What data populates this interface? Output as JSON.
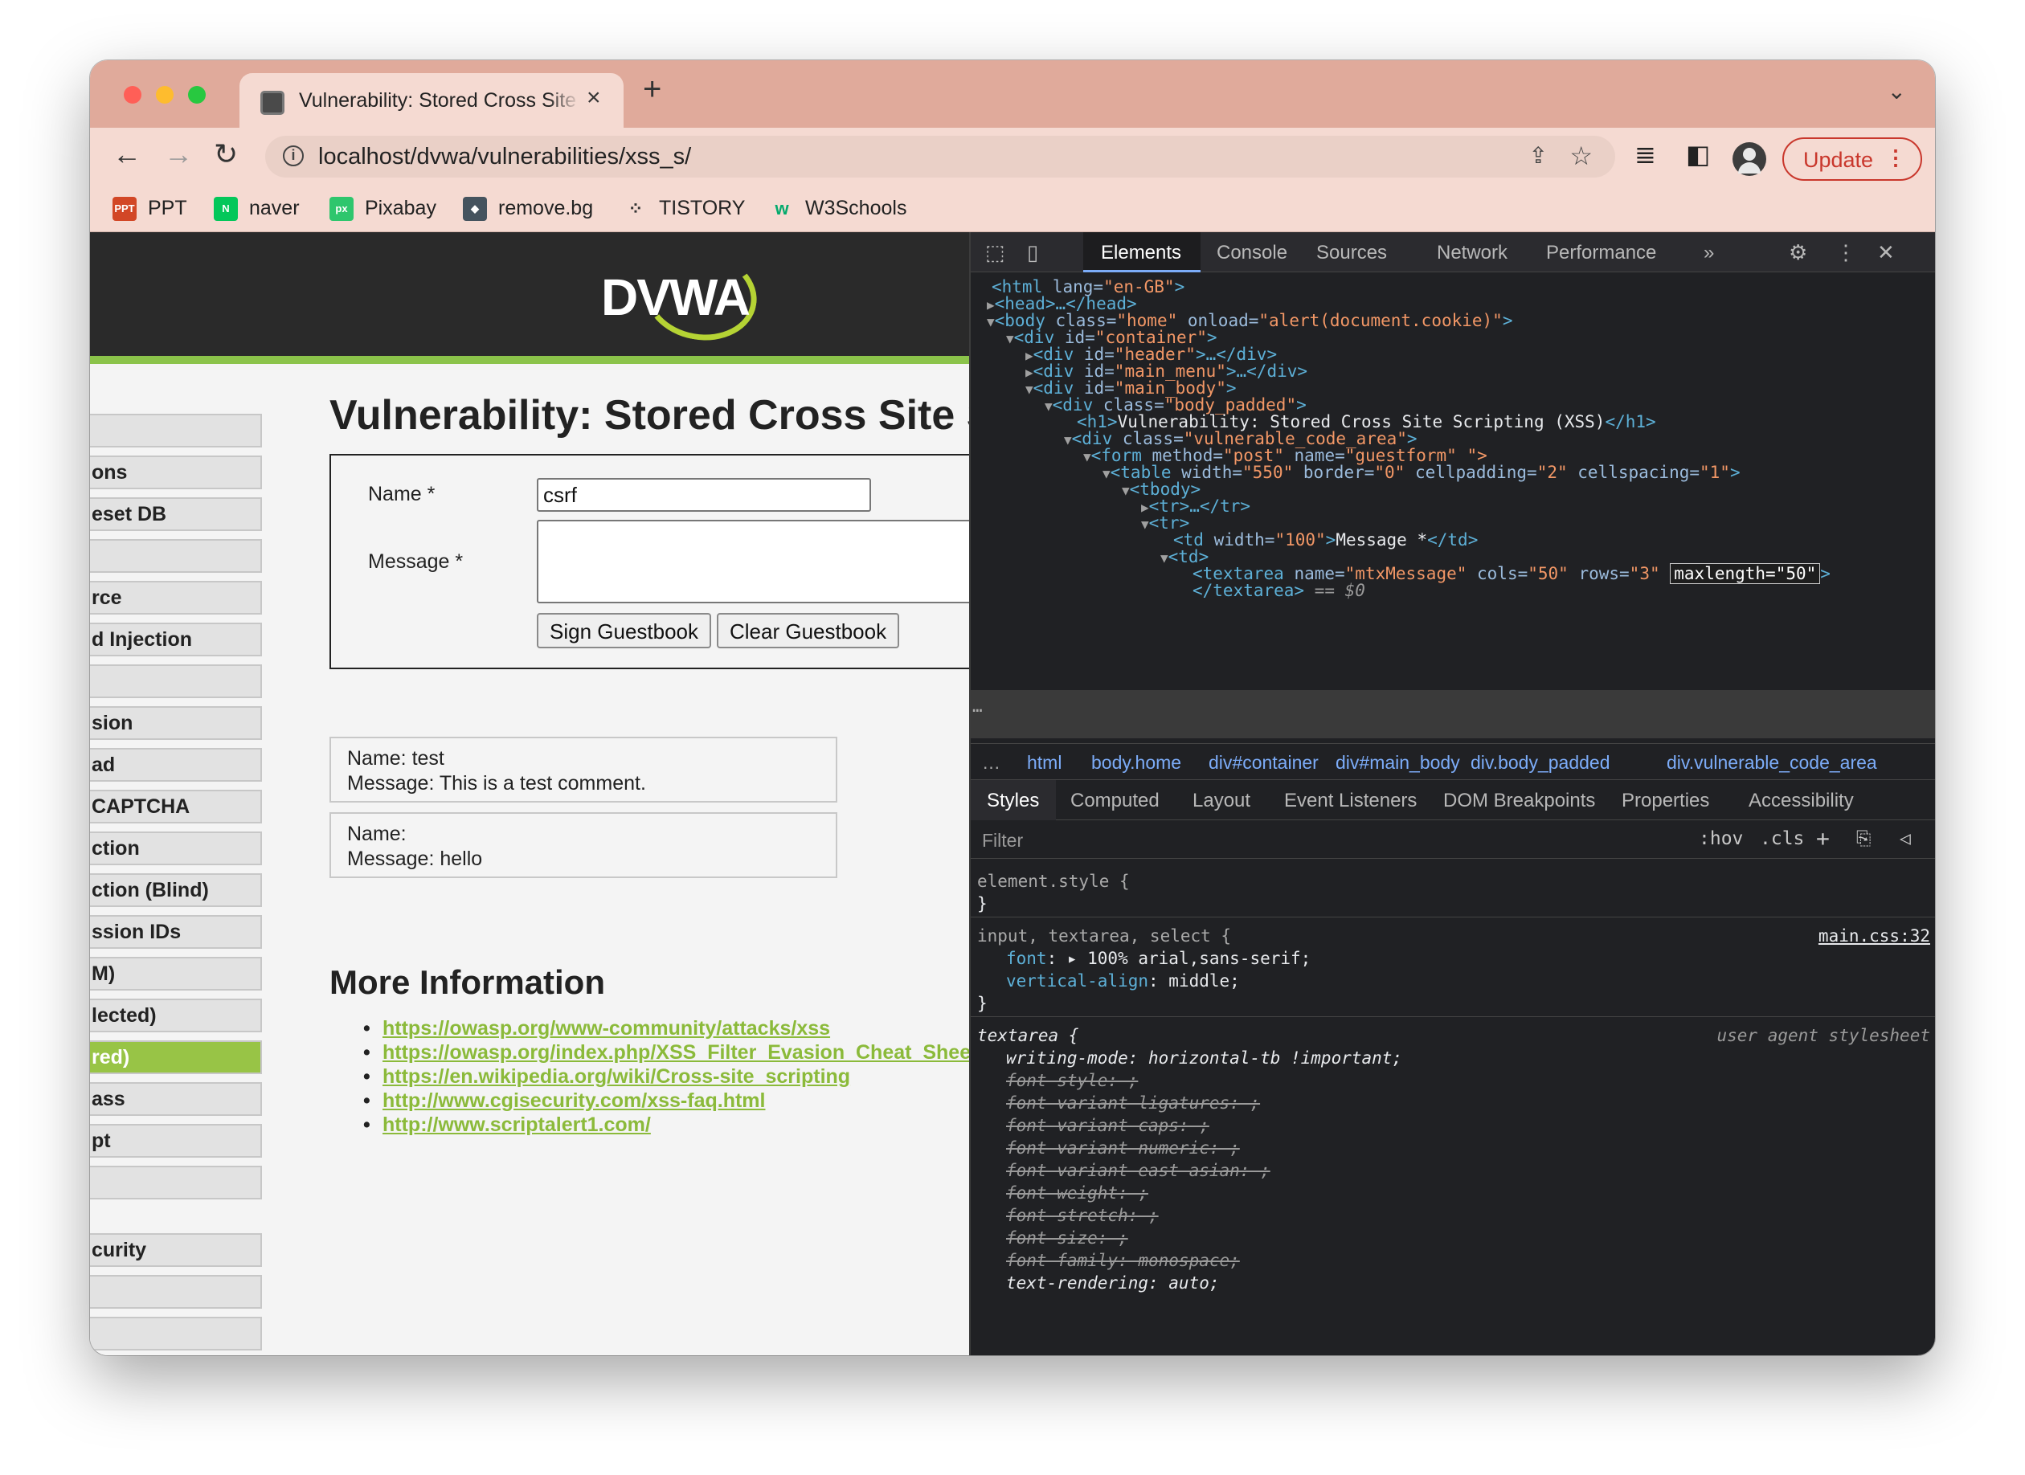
{
  "browser": {
    "tab_title": "Vulnerability: Stored Cross Site Scripting (XSS)",
    "tab_close": "×",
    "new_tab": "+",
    "url": "localhost/dvwa/vulnerabilities/xss_s/",
    "update_label": "Update",
    "bookmarks": [
      {
        "label": "PPT",
        "icon": "ppt-icon",
        "color": "#d24726"
      },
      {
        "label": "naver",
        "icon": "naver-icon",
        "color": "#03c75a"
      },
      {
        "label": "Pixabay",
        "icon": "pixabay-icon",
        "color": "#2ec66d"
      },
      {
        "label": "remove.bg",
        "icon": "removebg-icon",
        "color": "#45535e"
      },
      {
        "label": "TISTORY",
        "icon": "tistory-icon",
        "color": "#333333"
      },
      {
        "label": "W3Schools",
        "icon": "w3schools-icon",
        "color": "#04aa6d"
      }
    ]
  },
  "dvwa": {
    "logo": "DVWA",
    "menu": [
      {
        "label": ""
      },
      {
        "label": "ons"
      },
      {
        "label": "eset DB"
      },
      {
        "label": ""
      },
      {
        "label": "rce"
      },
      {
        "label": "d Injection"
      },
      {
        "label": ""
      },
      {
        "label": "sion"
      },
      {
        "label": "ad"
      },
      {
        "label": "CAPTCHA"
      },
      {
        "label": "ction"
      },
      {
        "label": "ction (Blind)"
      },
      {
        "label": "ssion IDs"
      },
      {
        "label": "M)"
      },
      {
        "label": "lected)"
      },
      {
        "label": "red)",
        "active": true
      },
      {
        "label": "ass"
      },
      {
        "label": "pt"
      },
      {
        "label": ""
      },
      {
        "label": "curity"
      },
      {
        "label": ""
      },
      {
        "label": ""
      }
    ],
    "heading": "Vulnerability: Stored Cross Site Scripting (XSS)",
    "form": {
      "name_label": "Name *",
      "name_value": "csrf",
      "message_label": "Message *",
      "sign_button": "Sign Guestbook",
      "clear_button": "Clear Guestbook"
    },
    "entries": [
      {
        "name": "Name: test",
        "message": "Message: This is a test comment."
      },
      {
        "name": "Name:",
        "message": "Message: hello"
      }
    ],
    "more_info_heading": "More Information",
    "links": [
      "https://owasp.org/www-community/attacks/xss",
      "https://owasp.org/index.php/XSS_Filter_Evasion_Cheat_Sheet",
      "https://en.wikipedia.org/wiki/Cross-site_scripting",
      "http://www.cgisecurity.com/xss-faq.html",
      "http://www.scriptalert1.com/"
    ]
  },
  "devtools": {
    "tabs": [
      "Elements",
      "Console",
      "Sources",
      "Network",
      "Performance",
      "»"
    ],
    "active_tab": "Elements",
    "dom": {
      "l1": {
        "open": "<html",
        "attr": " lang=",
        "val": "\"en-GB\"",
        "close": ">"
      },
      "l2": {
        "open": "<head>",
        "rest": "…</head>"
      },
      "l3": {
        "open": "<body",
        "a1": " class=",
        "v1": "\"home\"",
        "a2": " onload=",
        "v2": "\"alert(document.cookie)\"",
        "close": ">"
      },
      "l4": {
        "open": "<div",
        "a1": " id=",
        "v1": "\"container\"",
        "close": ">"
      },
      "l5": {
        "open": "<div",
        "a1": " id=",
        "v1": "\"header\"",
        "close": ">…</div>"
      },
      "l6": {
        "open": "<div",
        "a1": " id=",
        "v1": "\"main_menu\"",
        "close": ">…</div>"
      },
      "l7": {
        "open": "<div",
        "a1": " id=",
        "v1": "\"main_body\"",
        "close": ">"
      },
      "l8": {
        "open": "<div",
        "a1": " class=",
        "v1": "\"body_padded\"",
        "close": ">"
      },
      "l9": {
        "open": "<h1>",
        "text": "Vulnerability: Stored Cross Site Scripting (XSS)",
        "close": "</h1>"
      },
      "l10": {
        "open": "<div",
        "a1": " class=",
        "v1": "\"vulnerable_code_area\"",
        "close": ">"
      },
      "l11": {
        "open": "<form",
        "a1": " method=",
        "v1": "\"post\"",
        "a2": " name=",
        "v2": "\"guestform\"",
        "close": " \">"
      },
      "l12": {
        "open": "<table",
        "a1": " width=",
        "v1": "\"550\"",
        "a2": " border=",
        "v2": "\"0\"",
        "a3": " cellpadding=",
        "v3": "\"2\"",
        "a4": " cellspacing=",
        "v4": "\"1\"",
        "close": ">"
      },
      "l13": {
        "open": "<tbody>"
      },
      "l14": {
        "open": "<tr>",
        "rest": "…</tr>"
      },
      "l15": {
        "open": "<tr>"
      },
      "l16": {
        "open": "<td",
        "a1": " width=",
        "v1": "\"100\"",
        "close": ">",
        "text": "Message *",
        "end": "</td>"
      },
      "l17": {
        "open": "<td>"
      },
      "l18": {
        "open": "<textarea",
        "a1": " name=",
        "v1": "\"mtxMessage\"",
        "a2": " cols=",
        "v2": "\"50\"",
        "a3": " rows=",
        "v3": "\"3\"",
        "edit": "maxlength=\"50\"",
        "close": ">"
      },
      "l19": {
        "open": "</textarea>",
        "rest": " == $0"
      }
    },
    "ellipsis": "…",
    "breadcrumbs": [
      "html",
      "body.home",
      "div#container",
      "div#main_body",
      "div.body_padded",
      "div.vulnerable_code_area"
    ],
    "subtabs": [
      "Styles",
      "Computed",
      "Layout",
      "Event Listeners",
      "DOM Breakpoints",
      "Properties",
      "Accessibility"
    ],
    "filter_placeholder": "Filter",
    "filter_tools": [
      ":hov",
      ".cls",
      "+"
    ],
    "styles": {
      "element_style_open": "element.style {",
      "close_brace": "}",
      "rule1_selector": "input, textarea, select {",
      "rule1_source": "main.css:32",
      "rule1_p1_name": "font",
      "rule1_p1_value": ": ▸ 100% arial,sans-serif;",
      "rule1_p2_name": "vertical-align",
      "rule1_p2_value": ": middle;",
      "rule2_selector": "textarea {",
      "rule2_source": "user agent stylesheet",
      "rule2_props": [
        {
          "text": "writing-mode: horizontal-tb !important;",
          "struck": false
        },
        {
          "text": "font-style: ;",
          "struck": true
        },
        {
          "text": "font-variant-ligatures: ;",
          "struck": true
        },
        {
          "text": "font-variant-caps: ;",
          "struck": true
        },
        {
          "text": "font-variant-numeric: ;",
          "struck": true
        },
        {
          "text": "font-variant-east-asian: ;",
          "struck": true
        },
        {
          "text": "font-weight: ;",
          "struck": true
        },
        {
          "text": "font-stretch: ;",
          "struck": true
        },
        {
          "text": "font-size: ;",
          "struck": true
        },
        {
          "text": "font-family: monospace;",
          "struck": true
        },
        {
          "text": "text-rendering: auto;",
          "struck": false
        }
      ]
    }
  }
}
